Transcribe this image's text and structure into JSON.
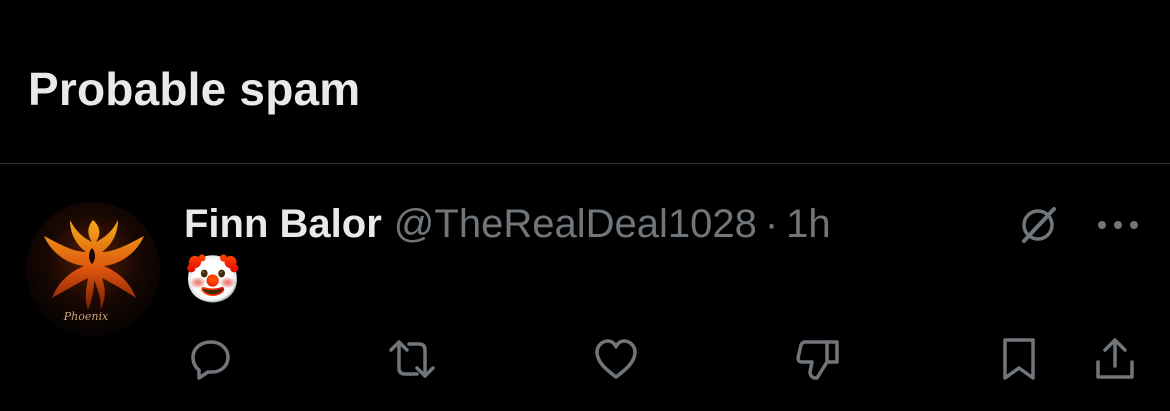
{
  "section": {
    "title": "Probable spam"
  },
  "post": {
    "author_name": "Finn Balor",
    "author_handle": "@TheRealDeal1028",
    "separator": "·",
    "timestamp": "1h",
    "text": "🤡",
    "avatar_icon": "phoenix-avatar",
    "avatar_text": "Phoenix"
  },
  "actions": {
    "icons": [
      "reply-icon",
      "repost-icon",
      "like-icon",
      "downvote-icon",
      "bookmark-icon",
      "share-icon"
    ]
  },
  "top_icons": [
    "grok-icon",
    "more-icon"
  ],
  "colors": {
    "background": "#000000",
    "primary_text": "#e7e9ea",
    "secondary_text": "#71767b",
    "divider": "#2f3336"
  }
}
